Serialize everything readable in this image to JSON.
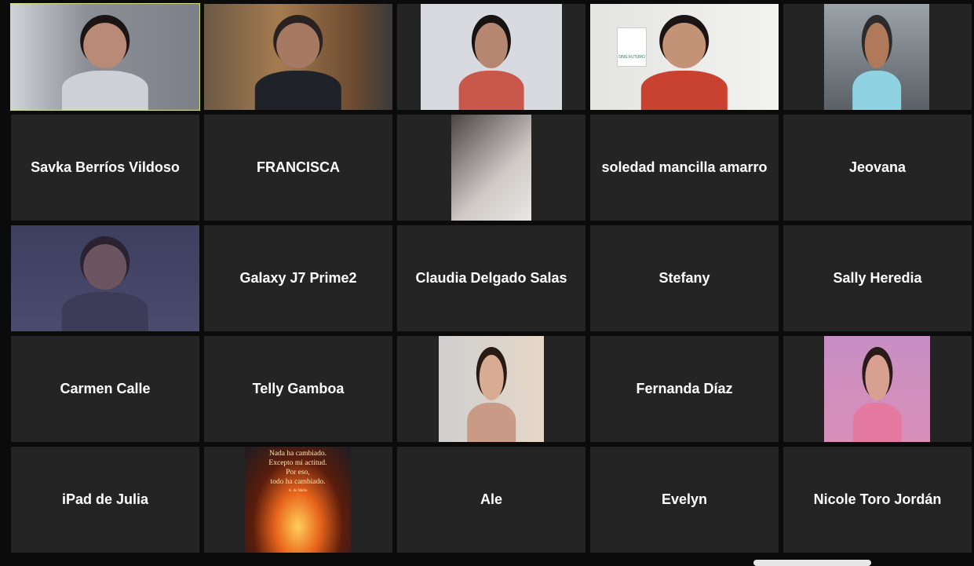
{
  "meeting": {
    "accent_active_speaker": "#d8e27a",
    "tile_background": "#242424",
    "participants": [
      {
        "name": "",
        "video": "on",
        "active": true
      },
      {
        "name": "",
        "video": "on"
      },
      {
        "name": "",
        "video": "on"
      },
      {
        "name": "",
        "video": "on",
        "logo_text": "ONG FUTURO"
      },
      {
        "name": "",
        "video": "on"
      },
      {
        "name": "Savka Berríos Vildoso",
        "video": "off"
      },
      {
        "name": "FRANCISCA",
        "video": "off"
      },
      {
        "name": "",
        "video": "on"
      },
      {
        "name": "soledad mancilla amarro",
        "video": "off"
      },
      {
        "name": "Jeovana",
        "video": "off"
      },
      {
        "name": "",
        "video": "on"
      },
      {
        "name": "Galaxy J7 Prime2",
        "video": "off"
      },
      {
        "name": "Claudia Delgado Salas",
        "video": "off"
      },
      {
        "name": "Stefany",
        "video": "off"
      },
      {
        "name": "Sally Heredia",
        "video": "off"
      },
      {
        "name": "Carmen Calle",
        "video": "off"
      },
      {
        "name": "Telly Gamboa",
        "video": "off"
      },
      {
        "name": "",
        "video": "on"
      },
      {
        "name": "Fernanda Díaz",
        "video": "off"
      },
      {
        "name": "",
        "video": "on"
      },
      {
        "name": "iPad de Julia",
        "video": "off"
      },
      {
        "name": "",
        "video": "image",
        "quote": [
          "Nada ha cambiado.",
          "Excepto mi actitud.",
          "Por eso,",
          "todo ha cambiado."
        ],
        "quote_author": "A. de Mello"
      },
      {
        "name": "Ale",
        "video": "off"
      },
      {
        "name": "Evelyn",
        "video": "off"
      },
      {
        "name": "Nicole Toro Jordán",
        "video": "off"
      }
    ]
  }
}
